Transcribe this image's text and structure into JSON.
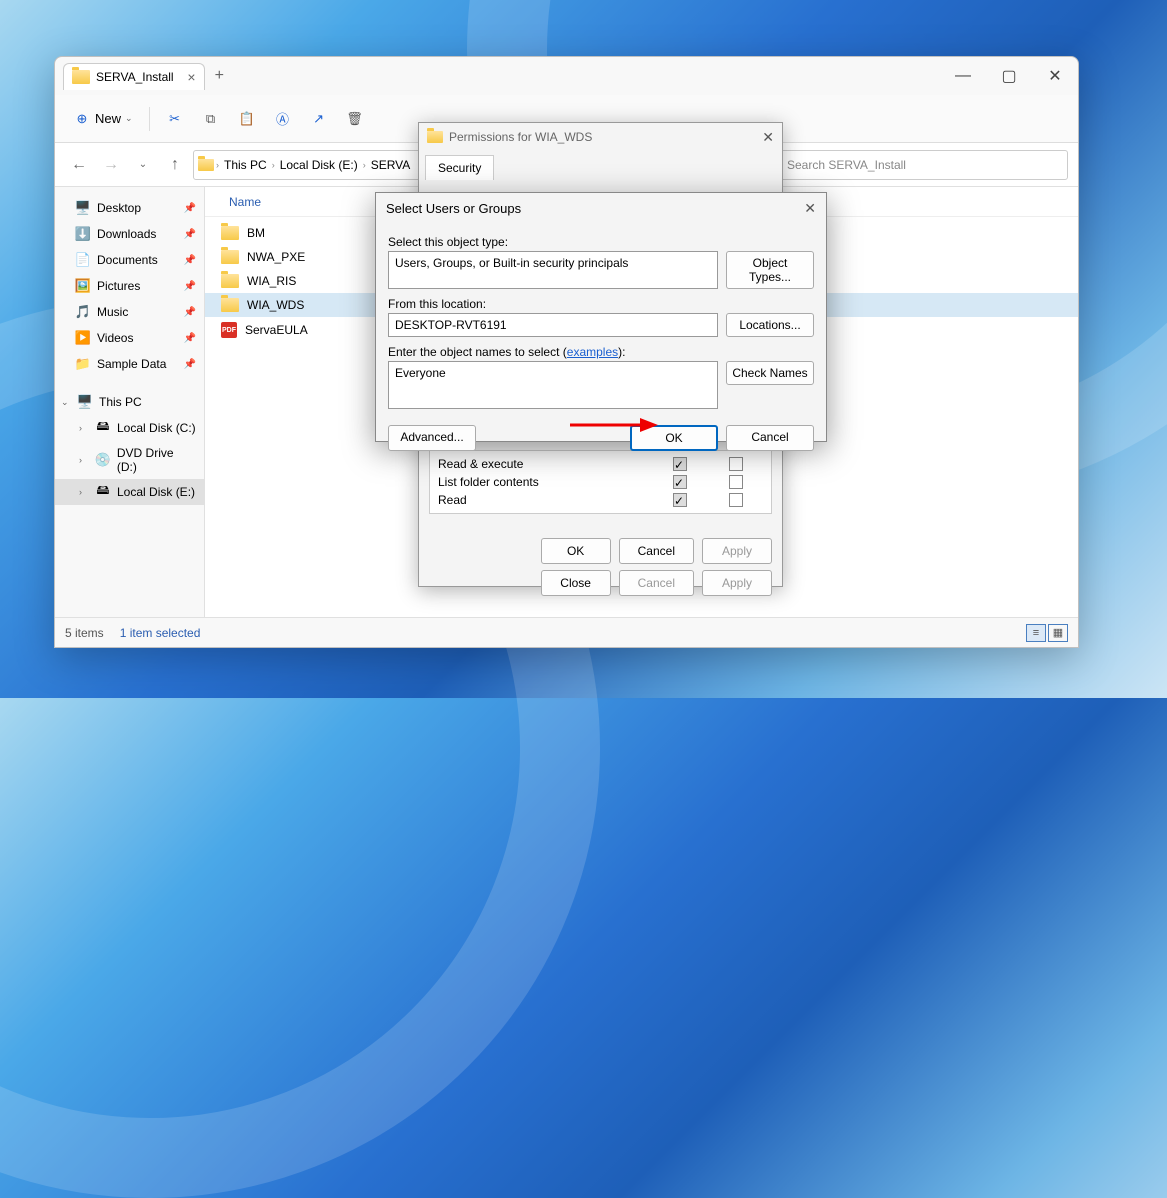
{
  "explorer": {
    "tab_title": "SERVA_Install",
    "toolbar": {
      "new_label": "New"
    },
    "breadcrumb": [
      "This PC",
      "Local Disk (E:)",
      "SERVA"
    ],
    "search_placeholder": "Search SERVA_Install",
    "nav_pane": {
      "quick": [
        {
          "label": "Desktop",
          "icon": "🖥️"
        },
        {
          "label": "Downloads",
          "icon": "⬇️"
        },
        {
          "label": "Documents",
          "icon": "📄"
        },
        {
          "label": "Pictures",
          "icon": "🖼️"
        },
        {
          "label": "Music",
          "icon": "🎵"
        },
        {
          "label": "Videos",
          "icon": "▶️"
        },
        {
          "label": "Sample Data",
          "icon": "📁"
        }
      ],
      "pc_label": "This PC",
      "drives": [
        {
          "label": "Local Disk (C:)"
        },
        {
          "label": "DVD Drive (D:)"
        },
        {
          "label": "Local Disk (E:)"
        }
      ]
    },
    "files": {
      "column": "Name",
      "items": [
        {
          "name": "BM",
          "type": "folder"
        },
        {
          "name": "NWA_PXE",
          "type": "folder"
        },
        {
          "name": "WIA_RIS",
          "type": "folder"
        },
        {
          "name": "WIA_WDS",
          "type": "folder",
          "selected": true
        },
        {
          "name": "ServaEULA",
          "type": "pdf"
        }
      ]
    },
    "status": {
      "count": "5 items",
      "selection": "1 item selected"
    }
  },
  "perms_dialog": {
    "title": "Permissions for WIA_WDS",
    "tab": "Security",
    "permissions": [
      "Read & execute",
      "List folder contents",
      "Read"
    ],
    "buttons": {
      "ok": "OK",
      "cancel": "Cancel",
      "apply": "Apply",
      "close": "Close"
    }
  },
  "select_dialog": {
    "title": "Select Users or Groups",
    "object_type_label": "Select this object type:",
    "object_type_value": "Users, Groups, or Built-in security principals",
    "object_types_btn": "Object Types...",
    "location_label": "From this location:",
    "location_value": "DESKTOP-RVT6191",
    "locations_btn": "Locations...",
    "names_label_prefix": "Enter the object names to select (",
    "names_label_link": "examples",
    "names_label_suffix": "):",
    "names_value": "Everyone",
    "check_names_btn": "Check Names",
    "advanced_btn": "Advanced...",
    "ok": "OK",
    "cancel": "Cancel"
  }
}
